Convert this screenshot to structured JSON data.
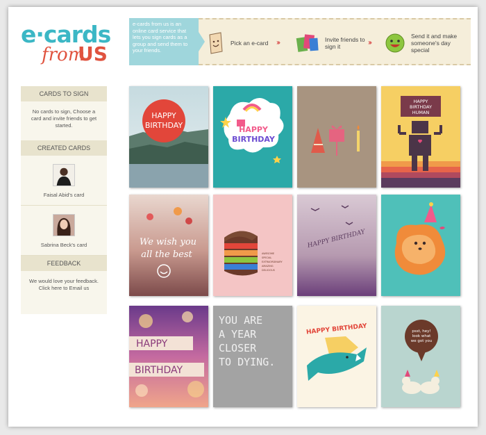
{
  "logo": {
    "part1": "e·cards",
    "part2": "from",
    "part3": "US"
  },
  "header": {
    "intro": "e-cards from us is an online card service that lets you sign cards as a group and send them to your friends.",
    "steps": [
      {
        "label": "Pick an e-card"
      },
      {
        "label": "Invite friends to sign it"
      },
      {
        "label": "Send it and make someone's day special"
      }
    ]
  },
  "sidebar": {
    "cards_to_sign": {
      "title": "CARDS TO SIGN",
      "text": "No cards to sign, Choose a card and invite friends to get started."
    },
    "created_cards": {
      "title": "CREATED CARDS",
      "items": [
        {
          "name": "Faisal Abid's card"
        },
        {
          "name": "Sabrina Beck's card"
        }
      ]
    },
    "feedback": {
      "title": "FEEDBACK",
      "text": "We would love your feedback. Click here to Email us"
    }
  },
  "cards": {
    "c1": {
      "l1": "HAPPY",
      "l2": "BIRTHDAY"
    },
    "c2": {
      "l1": "HAPPY",
      "l2": "BIRTHDAY"
    },
    "c4": {
      "l1": "HAPPY",
      "l2": "BIRTHDAY",
      "l3": "HUMAN"
    },
    "c5": {
      "l1": "We wish you",
      "l2": "all the best"
    },
    "c6": {
      "lines": [
        "AWESOME",
        "SPECIAL",
        "EXTRAORDINARY",
        "AMAZING",
        "DELICIOUS"
      ]
    },
    "c7": {
      "l1": "HAPPY BIRTHDAY"
    },
    "c9": {
      "l1": "HAPPY",
      "l2": "BIRTHDAY"
    },
    "c10": {
      "l1": "YOU ARE",
      "l2": "A YEAR",
      "l3": "CLOSER",
      "l4": "TO DYING."
    },
    "c11": {
      "l1": "HAPPY BIRTHDAY"
    },
    "c12": {
      "l1": "psst, hey!",
      "l2": "look what",
      "l3": "we got you"
    }
  },
  "colors": {
    "brand_teal": "#3bb7c5",
    "brand_red": "#e0533f",
    "banner_tan": "#f5eeda"
  }
}
